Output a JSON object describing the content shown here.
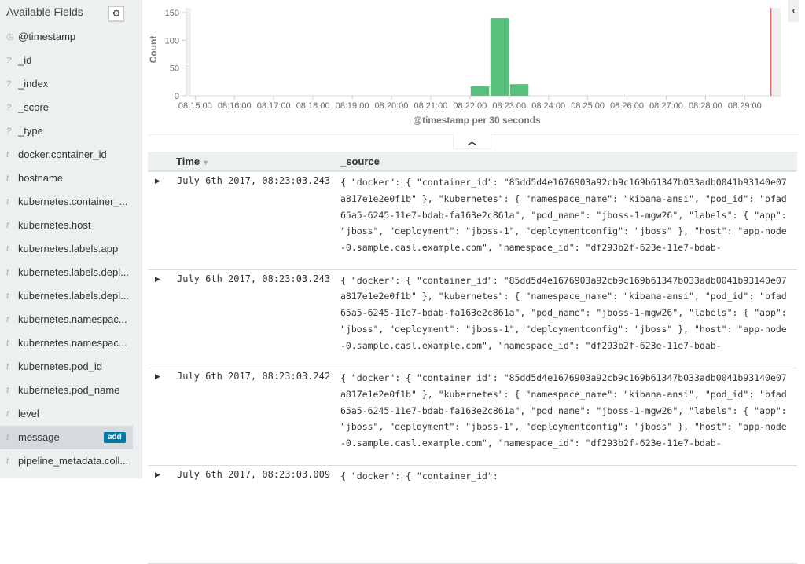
{
  "sidebar": {
    "title": "Available Fields",
    "fields": [
      {
        "type": "clock",
        "name": "@timestamp"
      },
      {
        "type": "?",
        "name": "_id"
      },
      {
        "type": "?",
        "name": "_index"
      },
      {
        "type": "?",
        "name": "_score"
      },
      {
        "type": "?",
        "name": "_type"
      },
      {
        "type": "t",
        "name": "docker.container_id"
      },
      {
        "type": "t",
        "name": "hostname"
      },
      {
        "type": "t",
        "name": "kubernetes.container_..."
      },
      {
        "type": "t",
        "name": "kubernetes.host"
      },
      {
        "type": "t",
        "name": "kubernetes.labels.app"
      },
      {
        "type": "t",
        "name": "kubernetes.labels.depl..."
      },
      {
        "type": "t",
        "name": "kubernetes.labels.depl..."
      },
      {
        "type": "t",
        "name": "kubernetes.namespac..."
      },
      {
        "type": "t",
        "name": "kubernetes.namespac..."
      },
      {
        "type": "t",
        "name": "kubernetes.pod_id"
      },
      {
        "type": "t",
        "name": "kubernetes.pod_name"
      },
      {
        "type": "t",
        "name": "level"
      },
      {
        "type": "t",
        "name": "message",
        "selected": true,
        "action": "add"
      },
      {
        "type": "t",
        "name": "pipeline_metadata.coll..."
      }
    ]
  },
  "chart_data": {
    "type": "bar",
    "ylabel": "Count",
    "xlabel": "@timestamp per 30 seconds",
    "ylim": [
      0,
      150
    ],
    "yticks": [
      "0",
      "50",
      "100",
      "150"
    ],
    "xticks": [
      "08:15:00",
      "08:16:00",
      "08:17:00",
      "08:18:00",
      "08:19:00",
      "08:20:00",
      "08:21:00",
      "08:22:00",
      "08:23:00",
      "08:24:00",
      "08:25:00",
      "08:26:00",
      "08:27:00",
      "08:28:00",
      "08:29:00"
    ],
    "bars": [
      {
        "x": "08:22:00",
        "value": 17
      },
      {
        "x": "08:22:30",
        "value": 140
      },
      {
        "x": "08:23:00",
        "value": 21
      }
    ],
    "now_marker": "08:29:40",
    "bar_color": "#57c17b",
    "marker_color": "#e06c6c"
  },
  "table": {
    "headers": {
      "time": "Time",
      "source": "_source"
    },
    "rows": [
      {
        "time": "July 6th 2017, 08:23:03.243",
        "source": "{ \"docker\": { \"container_id\": \"85dd5d4e1676903a92cb9c169b61347b033adb0041b93140e07a817e1e2e0f1b\" }, \"kubernetes\": { \"namespace_name\": \"kibana-ansi\", \"pod_id\": \"bfad65a5-6245-11e7-bdab-fa163e2c861a\", \"pod_name\": \"jboss-1-mgw26\", \"labels\": { \"app\": \"jboss\", \"deployment\": \"jboss-1\", \"deploymentconfig\": \"jboss\" }, \"host\": \"app-node-0.sample.casl.example.com\", \"namespace_id\": \"df293b2f-623e-11e7-bdab-"
      },
      {
        "time": "July 6th 2017, 08:23:03.243",
        "source": "{ \"docker\": { \"container_id\": \"85dd5d4e1676903a92cb9c169b61347b033adb0041b93140e07a817e1e2e0f1b\" }, \"kubernetes\": { \"namespace_name\": \"kibana-ansi\", \"pod_id\": \"bfad65a5-6245-11e7-bdab-fa163e2c861a\", \"pod_name\": \"jboss-1-mgw26\", \"labels\": { \"app\": \"jboss\", \"deployment\": \"jboss-1\", \"deploymentconfig\": \"jboss\" }, \"host\": \"app-node-0.sample.casl.example.com\", \"namespace_id\": \"df293b2f-623e-11e7-bdab-"
      },
      {
        "time": "July 6th 2017, 08:23:03.242",
        "source": "{ \"docker\": { \"container_id\": \"85dd5d4e1676903a92cb9c169b61347b033adb0041b93140e07a817e1e2e0f1b\" }, \"kubernetes\": { \"namespace_name\": \"kibana-ansi\", \"pod_id\": \"bfad65a5-6245-11e7-bdab-fa163e2c861a\", \"pod_name\": \"jboss-1-mgw26\", \"labels\": { \"app\": \"jboss\", \"deployment\": \"jboss-1\", \"deploymentconfig\": \"jboss\" }, \"host\": \"app-node-0.sample.casl.example.com\", \"namespace_id\": \"df293b2f-623e-11e7-bdab-"
      },
      {
        "time": "July 6th 2017, 08:23:03.009",
        "source": "{ \"docker\": { \"container_id\":"
      }
    ]
  }
}
